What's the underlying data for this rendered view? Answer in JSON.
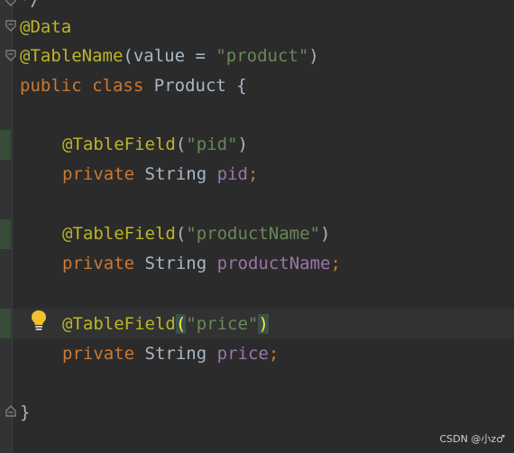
{
  "editor": {
    "top_partial": "*/",
    "line_annotation_data": "@Data",
    "annotation_tablename": "@TableName",
    "tablename_open": "(value = ",
    "tablename_value": "\"product\"",
    "tablename_close": ")",
    "kw_public": "public",
    "kw_class": "class",
    "class_name": "Product",
    "open_brace": "{",
    "fields": [
      {
        "annotation": "@TableField",
        "open": "(",
        "column": "\"pid\"",
        "close": ")",
        "kw": "private",
        "type": "String",
        "name": "pid",
        "semi": ";"
      },
      {
        "annotation": "@TableField",
        "open": "(",
        "column": "\"productName\"",
        "close": ")",
        "kw": "private",
        "type": "String",
        "name": "productName",
        "semi": ";"
      },
      {
        "annotation": "@TableField",
        "open": "(",
        "column": "\"price\"",
        "close": ")",
        "kw": "private",
        "type": "String",
        "name": "price",
        "semi": ";"
      }
    ],
    "close_brace": "}"
  },
  "watermark": "CSDN @小z♂",
  "colors": {
    "background": "#2b2b2b",
    "annotation": "#bbb529",
    "keyword": "#cc7832",
    "string": "#6a8759",
    "field": "#9876aa",
    "text": "#a9b7c6",
    "bulb": "#f2c12e"
  },
  "icons": [
    "fold-icon",
    "lightbulb-icon"
  ]
}
